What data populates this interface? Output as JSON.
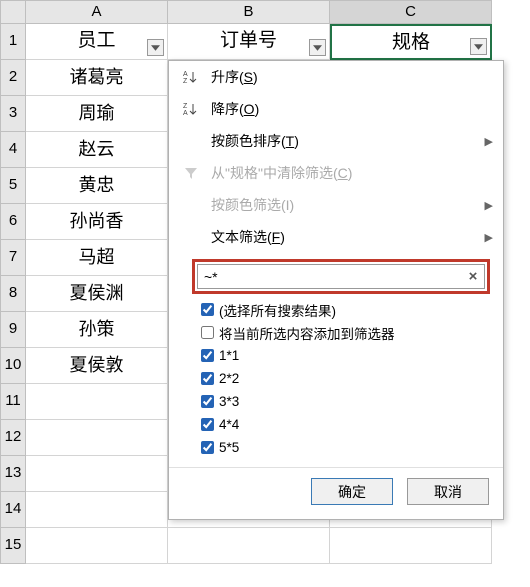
{
  "columns": {
    "A": "A",
    "B": "B",
    "C": "C"
  },
  "headers": {
    "A": "员工",
    "B": "订单号",
    "C": "规格"
  },
  "rows": [
    {
      "n": "1",
      "A": "员工",
      "B": "订单号",
      "C": "规格"
    },
    {
      "n": "2",
      "A": "诸葛亮"
    },
    {
      "n": "3",
      "A": "周瑜"
    },
    {
      "n": "4",
      "A": "赵云"
    },
    {
      "n": "5",
      "A": "黄忠"
    },
    {
      "n": "6",
      "A": "孙尚香"
    },
    {
      "n": "7",
      "A": "马超"
    },
    {
      "n": "8",
      "A": "夏侯渊"
    },
    {
      "n": "9",
      "A": "孙策"
    },
    {
      "n": "10",
      "A": "夏侯敦"
    },
    {
      "n": "11",
      "A": ""
    },
    {
      "n": "12",
      "A": ""
    },
    {
      "n": "13",
      "A": ""
    },
    {
      "n": "14",
      "A": ""
    },
    {
      "n": "15",
      "A": ""
    }
  ],
  "menu": {
    "sort_asc": "升序(S)",
    "sort_desc": "降序(O)",
    "sort_color": "按颜色排序(T)",
    "clear_filter": "从\"规格\"中清除筛选(C)",
    "filter_color": "按颜色筛选(I)",
    "text_filter": "文本筛选(F)"
  },
  "search": {
    "value": "~*",
    "clear": "×"
  },
  "checklist": {
    "select_all": "(选择所有搜索结果)",
    "add_current": "将当前所选内容添加到筛选器",
    "items": [
      "1*1",
      "2*2",
      "3*3",
      "4*4",
      "5*5"
    ]
  },
  "buttons": {
    "ok": "确定",
    "cancel": "取消"
  },
  "icons": {
    "sort_asc": "az-sort-asc-icon",
    "sort_desc": "za-sort-desc-icon",
    "funnel": "funnel-clear-icon"
  }
}
